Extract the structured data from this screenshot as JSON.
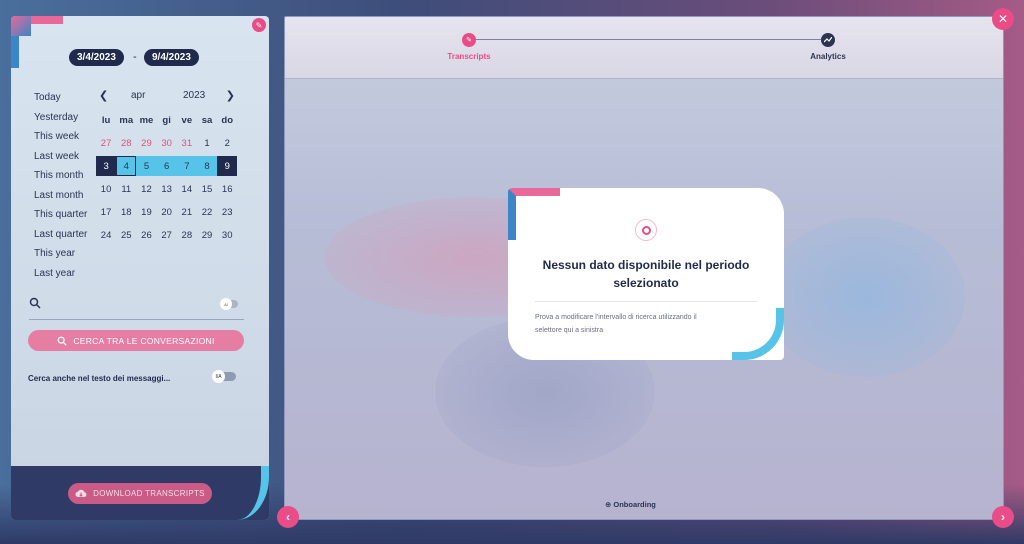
{
  "date_range": {
    "start": "3/4/2023",
    "separator": "-",
    "end": "9/4/2023"
  },
  "presets": [
    "Today",
    "Yesterday",
    "This week",
    "Last week",
    "This month",
    "Last month",
    "This quarter",
    "Last quarter",
    "This year",
    "Last year"
  ],
  "calendar": {
    "prev_icon": "chevron-left-icon",
    "next_icon": "chevron-right-icon",
    "month": "apr",
    "year": "2023",
    "weekdays": [
      "lu",
      "ma",
      "me",
      "gi",
      "ve",
      "sa",
      "do"
    ],
    "weeks": [
      [
        "27",
        "28",
        "29",
        "30",
        "31",
        "1",
        "2"
      ],
      [
        "3",
        "4",
        "5",
        "6",
        "7",
        "8",
        "9"
      ],
      [
        "10",
        "11",
        "12",
        "13",
        "14",
        "15",
        "16"
      ],
      [
        "17",
        "18",
        "19",
        "20",
        "21",
        "22",
        "23"
      ],
      [
        "24",
        "25",
        "26",
        "27",
        "28",
        "29",
        "30"
      ]
    ]
  },
  "search": {
    "icon": "search-icon",
    "ai_toggle_label": "AI",
    "button_label": "CERCA TRA LE CONVERSAZIONI",
    "message_search_label": "Cerca anche nel testo dei messaggi...",
    "message_toggle_label": "I/A"
  },
  "footer": {
    "download_label": "DOWNLOAD TRANSCRIPTS",
    "download_icon": "cloud-download-icon"
  },
  "steps": [
    {
      "label": "Transcripts",
      "icon": "pencil-icon",
      "active": true
    },
    {
      "label": "Analytics",
      "icon": "chart-icon",
      "active": false
    }
  ],
  "empty_state": {
    "icon": "target-icon",
    "title_line1": "Nessun dato disponibile nel periodo",
    "title_line2": "selezionato",
    "text_line1": "Prova a modificare l'intervallo di ricerca utilizzando il",
    "text_line2": "selettore qui a sinistra"
  },
  "onboarding_label": "Onboarding",
  "colors": {
    "accent": "#e94c86",
    "navy": "#1f2a4c",
    "range": "#56c3e8",
    "prev_month": "#e0507f"
  }
}
